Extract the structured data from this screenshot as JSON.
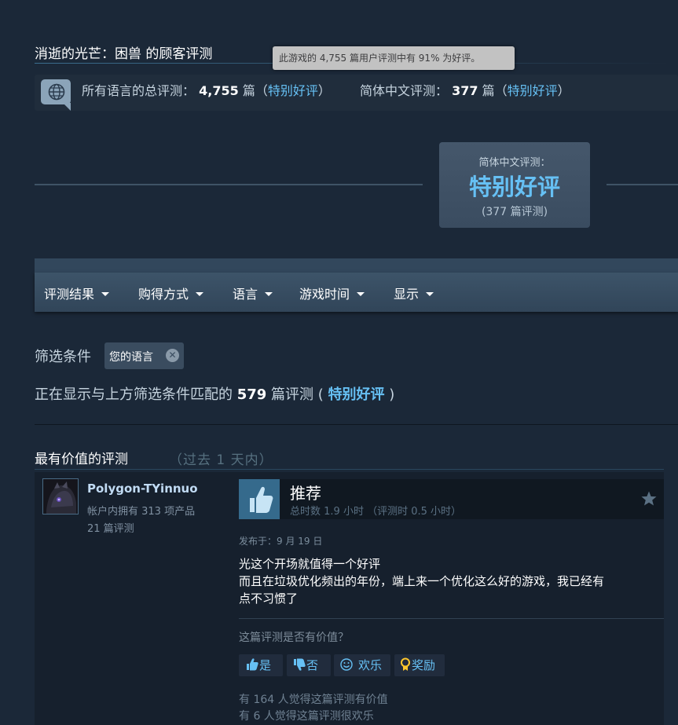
{
  "header": {
    "title": "消逝的光芒：困兽 的顾客评测",
    "tooltip": "此游戏的 4,755 篇用户评测中有 91% 为好评。"
  },
  "summary": {
    "all_label": "所有语言的总评测：",
    "all_count": "4,755",
    "unit": "篇",
    "all_rating": "特别好评",
    "cn_label": "简体中文评测：",
    "cn_count": "377",
    "cn_rating": "特别好评",
    "paren_open": "（",
    "paren_close": "）"
  },
  "score_box": {
    "label": "简体中文评测：",
    "rating": "特别好评",
    "count": "(377 篇评测)"
  },
  "filter_menu": {
    "items": [
      "评测结果",
      "购得方式",
      "语言",
      "游戏时间",
      "显示"
    ]
  },
  "filters": {
    "label": "筛选条件",
    "chip": "您的语言",
    "showing_prefix": "正在显示与上方筛选条件匹配的",
    "showing_count": "579",
    "showing_mid": "篇评测 (",
    "showing_rating": "特别好评",
    "showing_suffix": ")"
  },
  "helpful": {
    "title": "最有价值的评测",
    "period": "（过去 1 天内）"
  },
  "review": {
    "author": "Polygon-TYinnuo",
    "products": "帐户内拥有 313 项产品",
    "reviews": "21 篇评测",
    "verdict": "推荐",
    "hours": "总时数 1.9 小时 （评测时 0.5 小时）",
    "posted": "发布于：9 月 19 日",
    "lines": [
      "光这个开场就值得一个好评",
      "而且在垃圾优化频出的年份，端上来一个优化这么好的游戏，我已经有",
      "点不习惯了"
    ],
    "helpful_question": "这篇评测是否有价值？",
    "buttons": {
      "yes": "是",
      "no": "否",
      "funny": "欢乐",
      "award": "奖励"
    },
    "stats": [
      "有 164 人觉得这篇评测有价值",
      "有 6 人觉得这篇评测很欢乐"
    ]
  },
  "colors": {
    "background": "#1b2838",
    "link": "#66c0f4",
    "thumb_box": "#356a8c"
  }
}
